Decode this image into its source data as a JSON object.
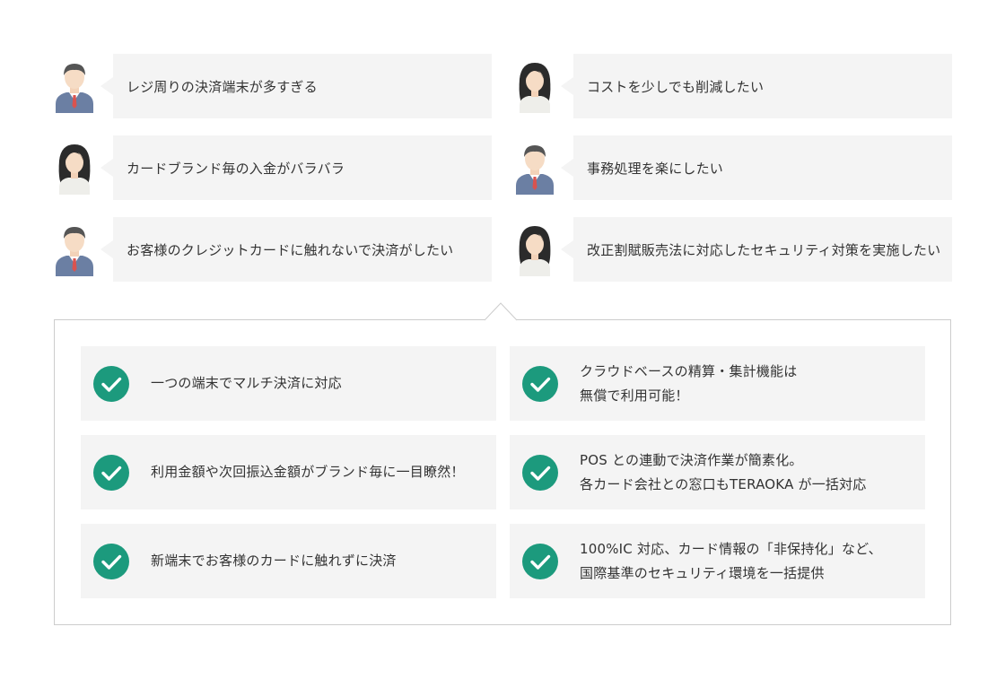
{
  "concerns": [
    {
      "text": "レジ周りの決済端末が多すぎる",
      "avatar": "man-avatar-icon"
    },
    {
      "text": "コストを少しでも削減したい",
      "avatar": "woman-avatar-icon"
    },
    {
      "text": "カードブランド毎の入金がバラバラ",
      "avatar": "woman-avatar-icon"
    },
    {
      "text": "事務処理を楽にしたい",
      "avatar": "man-avatar-icon"
    },
    {
      "text": "お客様のクレジットカードに触れないで決済がしたい",
      "avatar": "man-avatar-icon"
    },
    {
      "text": "改正割賦販売法に対応したセキュリティ対策を実施したい",
      "avatar": "woman-avatar-icon"
    }
  ],
  "benefits": [
    {
      "lines": [
        "一つの端末でマルチ決済に対応"
      ],
      "icon": "check-icon"
    },
    {
      "lines": [
        "クラウドベースの精算・集計機能は",
        "無償で利用可能！"
      ],
      "icon": "check-icon"
    },
    {
      "lines": [
        "利用金額や次回振込金額がブランド毎に一目瞭然！"
      ],
      "icon": "check-icon"
    },
    {
      "lines": [
        "POS との連動で決済作業が簡素化。",
        "各カード会社との窓口もTERAOKA が一括対応"
      ],
      "icon": "check-icon"
    },
    {
      "lines": [
        "新端末でお客様のカードに触れずに決済"
      ],
      "icon": "check-icon"
    },
    {
      "lines": [
        "100%IC 対応、カード情報の「非保持化」など、",
        "国際基準のセキュリティ環境を一括提供"
      ],
      "icon": "check-icon"
    }
  ],
  "colors": {
    "accent_green": "#1c9a7d",
    "panel_gray": "#f4f4f4",
    "border": "#cccccc",
    "suit_blue": "#6b7fa3",
    "tie_red": "#d9534f",
    "hair_dark": "#2b2b2b"
  }
}
